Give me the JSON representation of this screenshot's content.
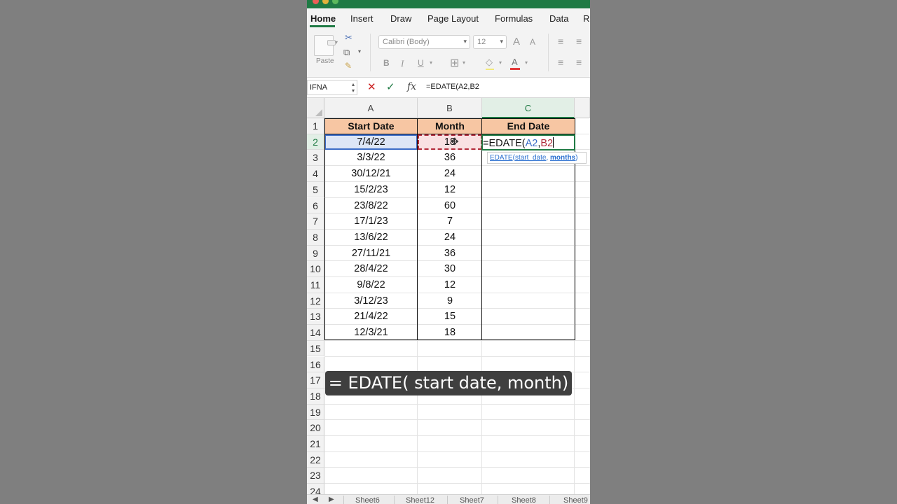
{
  "ribbon": {
    "tabs": [
      "Home",
      "Insert",
      "Draw",
      "Page Layout",
      "Formulas",
      "Data",
      "Re"
    ],
    "paste_label": "Paste",
    "font_name": "Calibri (Body)",
    "font_size": "12",
    "bold": "B",
    "italic": "I",
    "underline": "U",
    "grow_font": "A",
    "shrink_font": "A",
    "font_color": "A"
  },
  "formula_bar": {
    "name_box": "IFNA",
    "cancel": "✕",
    "enter": "✓",
    "fx": "fx",
    "formula": "=EDATE(A2,B2"
  },
  "columns": [
    "A",
    "B",
    "C"
  ],
  "header_row": {
    "a": "Start Date",
    "b": "Month",
    "c": "End Date"
  },
  "rows": [
    {
      "a": "7/4/22",
      "b": "18"
    },
    {
      "a": "3/3/22",
      "b": "36"
    },
    {
      "a": "30/12/21",
      "b": "24"
    },
    {
      "a": "15/2/23",
      "b": "12"
    },
    {
      "a": "23/8/22",
      "b": "60"
    },
    {
      "a": "17/1/23",
      "b": "7"
    },
    {
      "a": "13/6/22",
      "b": "24"
    },
    {
      "a": "27/11/21",
      "b": "36"
    },
    {
      "a": "28/4/22",
      "b": "30"
    },
    {
      "a": "9/8/22",
      "b": "12"
    },
    {
      "a": "3/12/23",
      "b": "9"
    },
    {
      "a": "21/4/22",
      "b": "15"
    },
    {
      "a": "12/3/21",
      "b": "18"
    }
  ],
  "row_numbers": [
    "1",
    "2",
    "3",
    "4",
    "5",
    "6",
    "7",
    "8",
    "9",
    "10",
    "11",
    "12",
    "13",
    "14",
    "15",
    "16",
    "17",
    "18",
    "19",
    "20",
    "21",
    "22",
    "23",
    "24"
  ],
  "edit_cell": {
    "prefix": "=EDATE(",
    "ref_a": "A2",
    "comma": ",",
    "ref_b": "B2"
  },
  "tooltip": {
    "func": "EDATE",
    "open": "(",
    "arg1": "start_date",
    "sep": ", ",
    "arg2": "months",
    "close": ")"
  },
  "caption": "= EDATE( start date, month)",
  "sheet_tabs": [
    "Sheet6",
    "Sheet12",
    "Sheet7",
    "Sheet8",
    "Sheet9"
  ],
  "colors": {
    "header_fill": "#f7c6a3",
    "accent": "#1f7a44",
    "ref_a": "#3b6cc7",
    "ref_b": "#b22a3a"
  }
}
